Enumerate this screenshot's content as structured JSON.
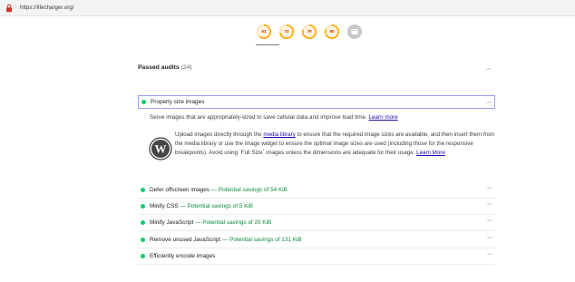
{
  "browser": {
    "url": "https://lifecharger.org/",
    "lock_icon": "lock-icon"
  },
  "gauges": [
    {
      "value": "61",
      "score": 0.61,
      "color": "#ffa400"
    },
    {
      "value": "72",
      "score": 0.72,
      "color": "#ffa400"
    },
    {
      "value": "79",
      "score": 0.79,
      "color": "#ffa400"
    },
    {
      "value": "80",
      "score": 0.8,
      "color": "#ffa400"
    },
    {
      "value": "",
      "score": 0,
      "color": "#b6b6b6",
      "icon": "pwa-icon"
    }
  ],
  "passed_audits": {
    "title": "Passed audits",
    "count": "(24)",
    "expanded_audit": {
      "title": "Properly size images",
      "description": "Serve images that are appropriately-sized to save cellular data and improve load time.",
      "learn_more": "Learn more",
      "wp_note_before": "Upload images directly through the",
      "wp_note_link": "media library",
      "wp_note_after": "to ensure that the required image sizes are available, and then insert them from the media library or use the image widget to ensure the optimal image sizes are used (including those for the responsive breakpoints). Avoid using `Full Size` images unless the dimensions are adequate for their usage.",
      "wp_learn_more": "Learn More",
      "wp_icon": "wordpress-icon"
    },
    "audits": [
      {
        "title": "Defer offscreen images",
        "savings": "— Potential savings of 54 KiB"
      },
      {
        "title": "Minify CSS",
        "savings": "— Potential savings of 5 KiB"
      },
      {
        "title": "Minify JavaScript",
        "savings": "— Potential savings of 20 KiB"
      },
      {
        "title": "Remove unused JavaScript",
        "savings": "— Potential savings of 131 KiB"
      },
      {
        "title": "Efficiently encode images",
        "savings": ""
      }
    ]
  },
  "colors": {
    "pass": "#0cce6b",
    "average": "#ffa400",
    "savings_text": "#0d8a40",
    "link": "#1a0dab"
  },
  "icons": {
    "chevron_up": "chevron-up-icon",
    "chevron_down": "chevron-down-icon"
  }
}
